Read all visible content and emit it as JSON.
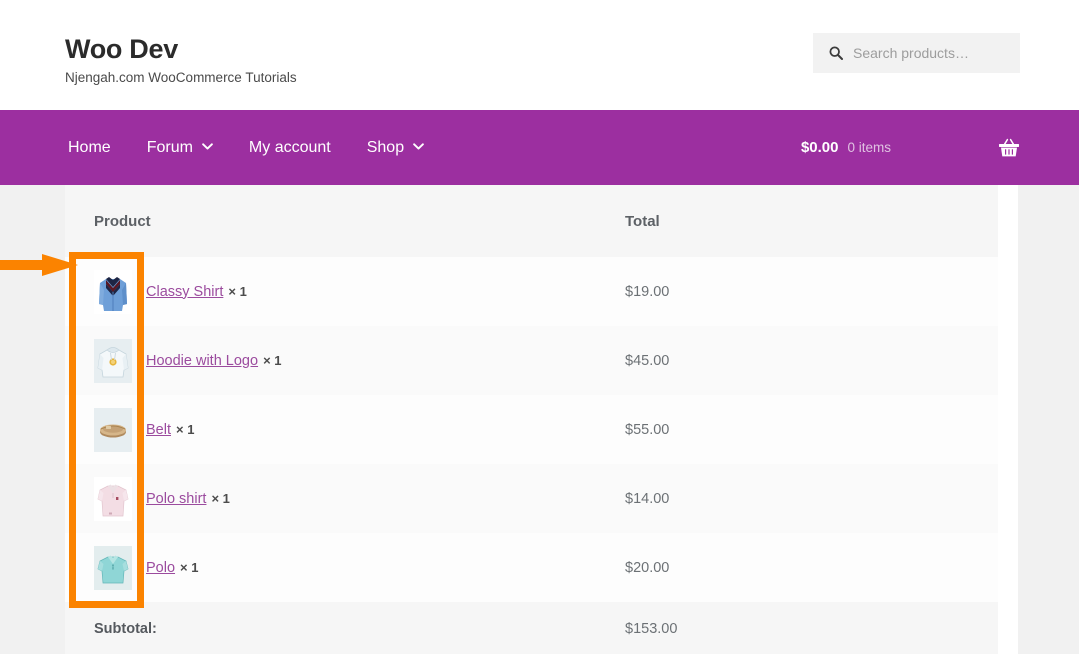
{
  "header": {
    "brand_title": "Woo Dev",
    "brand_tagline": "Njengah.com WooCommerce Tutorials",
    "search": {
      "icon": "search-icon",
      "placeholder": "Search products…",
      "value": ""
    }
  },
  "nav": {
    "items": [
      {
        "label": "Home",
        "has_dropdown": false,
        "chevron": ""
      },
      {
        "label": "Forum",
        "has_dropdown": true,
        "chevron": "❯"
      },
      {
        "label": "My account",
        "has_dropdown": false,
        "chevron": ""
      },
      {
        "label": "Shop",
        "has_dropdown": true,
        "chevron": "❯"
      }
    ],
    "cart": {
      "amount": "$0.00",
      "items_count": "0 items",
      "icon": "shopping-basket-icon"
    }
  },
  "cart_table": {
    "headers": {
      "product": "Product",
      "total": "Total"
    },
    "rows": [
      {
        "name": "Classy Shirt",
        "qty": "× 1",
        "total": "$19.00",
        "thumb": "blue-dress-shirt-thumb"
      },
      {
        "name": "Hoodie with Logo",
        "qty": "× 1",
        "total": "$45.00",
        "thumb": "grey-hoodie-thumb"
      },
      {
        "name": "Belt",
        "qty": "× 1",
        "total": "$55.00",
        "thumb": "brown-belt-thumb"
      },
      {
        "name": "Polo shirt",
        "qty": "× 1",
        "total": "$14.00",
        "thumb": "pink-polo-thumb"
      },
      {
        "name": "Polo",
        "qty": "× 1",
        "total": "$20.00",
        "thumb": "teal-polo-thumb"
      }
    ],
    "subtotal": {
      "label": "Subtotal:",
      "value": "$153.00"
    }
  },
  "annotation": {
    "box_color": "#fb8300",
    "arrow_color": "#fb8300",
    "target": "product-thumbnail-column"
  },
  "colors": {
    "nav_purple": "#9c2fa0",
    "link_purple": "#9b4b9e",
    "page_background": "#f1f1f1",
    "annotation_orange": "#fb8300"
  }
}
